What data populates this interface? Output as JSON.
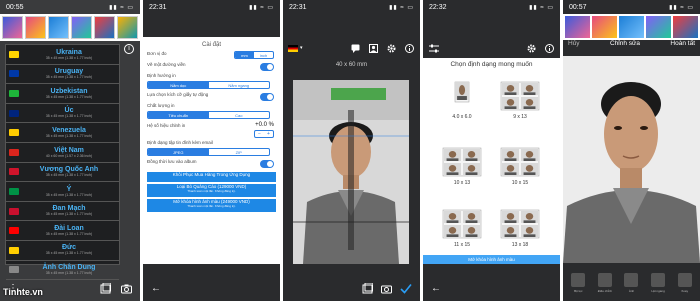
{
  "screen1": {
    "time": "00:55",
    "status_icons": "▮▮ ≈ ▭",
    "countries": [
      {
        "name": "Ukraina",
        "size": "35 x 45 mm (1.38 x 1.77 inch)",
        "color": "#ffd500"
      },
      {
        "name": "Uruguay",
        "size": "35 x 45 mm (1.38 x 1.77 inch)",
        "color": "#0038a8"
      },
      {
        "name": "Uzbekistan",
        "size": "35 x 45 mm (1.38 x 1.77 inch)",
        "color": "#1eb53a"
      },
      {
        "name": "Úc",
        "size": "35 x 45 mm (1.38 x 1.77 inch)",
        "color": "#00247d"
      },
      {
        "name": "Venezuela",
        "size": "35 x 45 mm (1.38 x 1.77 inch)",
        "color": "#ffcc00"
      },
      {
        "name": "Việt Nam",
        "size": "40 x 60 mm (1.57 x 2.36 inch)",
        "color": "#da251d"
      },
      {
        "name": "Vương Quốc Anh",
        "size": "35 x 45 mm (1.38 x 1.77 inch)",
        "color": "#cf142b"
      },
      {
        "name": "Ý",
        "size": "35 x 45 mm (1.38 x 1.77 inch)",
        "color": "#009246"
      },
      {
        "name": "Đan Mạch",
        "size": "35 x 45 mm (1.38 x 1.77 inch)",
        "color": "#c8102e"
      },
      {
        "name": "Đài Loan",
        "size": "35 x 45 mm (1.38 x 1.77 inch)",
        "color": "#fe0000"
      },
      {
        "name": "Đức",
        "size": "35 x 45 mm (1.38 x 1.77 inch)",
        "color": "#ffce00"
      },
      {
        "name": "Ảnh Chân Dung",
        "size": "35 x 45 mm (1.38 x 1.77 inch)",
        "color": "#888888"
      }
    ],
    "watermark": "Tinhte.vn"
  },
  "screen2": {
    "time": "22:31",
    "title": "Cài đặt",
    "unit_label": "Đơn vị đo",
    "unit_options": [
      "mm",
      "inch"
    ],
    "border_label": "Vẽ một đường viền",
    "orientation_label": "Định hướng in",
    "orientation_options": [
      "Nằm dọc",
      "Nằm ngang"
    ],
    "auto_paper_label": "Lựa chọn kích cỡ giấy tự động",
    "quality_label": "Chất lượng in",
    "quality_options": [
      "Tiêu chuẩn",
      "Cao"
    ],
    "correction_label": "Hệ số hiệu chỉnh in",
    "correction_value": "+0.0 %",
    "email_format_label": "Định dạng tập tin đính kèm email",
    "email_format_options": [
      "JPEG",
      "ZIP"
    ],
    "sync_label": "Đồng thời lưu vào album",
    "restore_button": "Khôi Phục Mua Hàng Trong Ứng Dụng",
    "remove_ads": "Loại Bỏ Quảng Cáo (129000 VND)",
    "remove_ads_sub": "Thanh toán một lần. Không đăng ký.",
    "unlock_all": "Mở khóa hình ảnh màu (249000 VND)",
    "unlock_all_sub": "Thanh toán một lần. Không đăng ký."
  },
  "screen3": {
    "time": "22:31",
    "dimension": "40 x 60 mm"
  },
  "screen4": {
    "time": "22:32",
    "title": "Chọn định dạng mong muốn",
    "formats": [
      "4.0 x 6.0",
      "9 x 13",
      "10 x 13",
      "10 x 15",
      "11 x 15",
      "13 x 18"
    ],
    "unlock_label": "Mở khóa hình ảnh màu"
  },
  "screen5": {
    "time": "00:57",
    "cancel": "Hủy",
    "edit": "Chỉnh sửa",
    "done": "Hoàn tất",
    "tools": [
      "Bộ lọc",
      "Điều chỉnh",
      "Ảnh",
      "Lật ngang",
      "Xoay"
    ]
  }
}
